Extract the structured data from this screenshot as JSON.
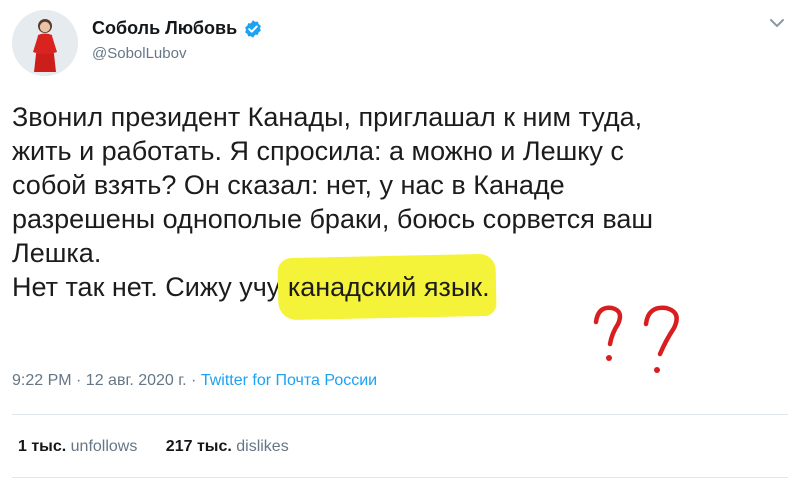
{
  "author": {
    "display_name": "Соболь Любовь",
    "handle": "@SobolLubov"
  },
  "tweet": {
    "lines": [
      "Звонил президент Канады, приглашал к ним туда,",
      "жить и работать. Я спросила: а можно и Лешку с",
      "собой взять? Он сказал: нет, у нас в Канаде",
      "разрешены однополые браки, боюсь сорвется ваш",
      "Лешка."
    ],
    "last_line_prefix": "Нет так нет. Сижу учу ",
    "highlighted_text": "канадский язык.",
    "annotation": "??"
  },
  "meta": {
    "timestamp": "9:22 PM · 12 авг. 2020 г. · ",
    "source": "Twitter for Почта России"
  },
  "stats": [
    {
      "count": "1 тыс.",
      "label": "unfollows"
    },
    {
      "count": "217 тыс.",
      "label": "dislikes"
    }
  ],
  "colors": {
    "verified_badge": "#1da1f2",
    "highlight": "#f4f239",
    "annotation": "#d81e1e",
    "link": "#1da1f2"
  },
  "icons": [
    "verified-badge-icon",
    "chevron-down-icon"
  ]
}
